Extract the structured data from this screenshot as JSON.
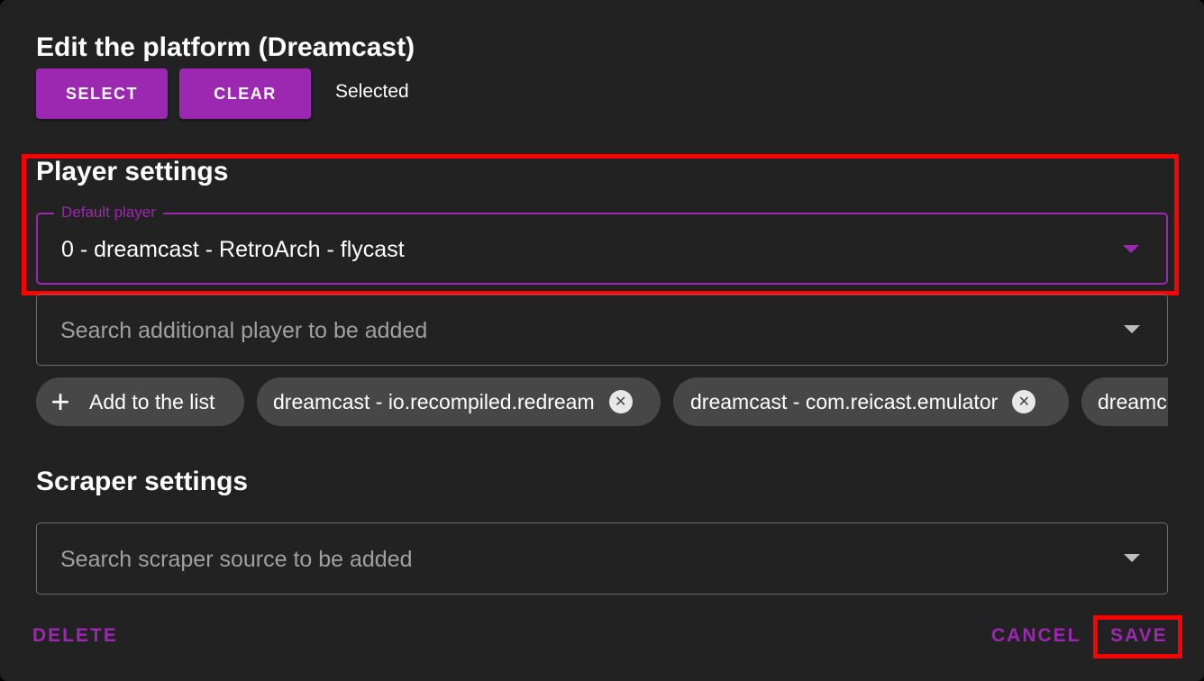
{
  "dialog": {
    "title": "Edit the platform (Dreamcast)",
    "select_label": "SELECT",
    "clear_label": "CLEAR",
    "selected_status": "Selected"
  },
  "player_settings": {
    "heading": "Player settings",
    "default_player_legend": "Default player",
    "default_player_value": "0 - dreamcast - RetroArch - flycast",
    "additional_player_placeholder": "Search additional player to be added",
    "add_chip_label": "Add to the list",
    "chips": [
      "dreamcast - io.recompiled.redream",
      "dreamcast - com.reicast.emulator",
      "dreamc"
    ]
  },
  "scraper_settings": {
    "heading": "Scraper settings",
    "source_placeholder": "Search scraper source to be added"
  },
  "actions": {
    "delete_label": "DELETE",
    "cancel_label": "CANCEL",
    "save_label": "SAVE"
  },
  "colors": {
    "accent": "#9c27b0",
    "background": "#222222",
    "highlight": "#ff0000",
    "chip": "#474747"
  },
  "icons": {
    "add": "plus-icon",
    "remove": "close-circle-icon",
    "dropdown": "caret-down-icon"
  }
}
